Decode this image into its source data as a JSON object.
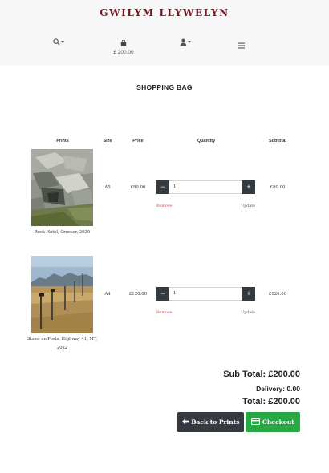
{
  "brand": "GWILYM LLYWELYN",
  "nav": {
    "search_icon": "search-icon",
    "bag_icon": "shopping-bag-icon",
    "bag_total": "£ 200.00",
    "account_icon": "user-icon",
    "menu_icon": "hamburger-icon"
  },
  "page_title": "SHOPPING BAG",
  "table": {
    "headers": {
      "prints": "Prints",
      "size": "Size",
      "price": "Price",
      "quantity": "Quantity",
      "subtotal": "Subtotal"
    },
    "rows": [
      {
        "title": "Rock Hotel, Croesor, 2020",
        "size": "A5",
        "price": "£80.00",
        "quantity": "1",
        "subtotal": "£80.00",
        "remove_label": "Remove",
        "update_label": "Update"
      },
      {
        "title": "Shoes on Posts, Highway 41, MT, 2022",
        "size": "A4",
        "price": "£120.00",
        "quantity": "1",
        "subtotal": "£120.00",
        "remove_label": "Remove",
        "update_label": "Update"
      }
    ]
  },
  "totals": {
    "sub_total": "Sub Total: £200.00",
    "delivery": "Delivery: 0.00",
    "total": "Total: £200.00"
  },
  "actions": {
    "back_label": "Back to Prints",
    "checkout_label": "Checkout"
  },
  "colors": {
    "brand": "#7a1620",
    "checkout": "#28a745",
    "dark_button": "#343a40",
    "remove": "#d64a4a"
  }
}
